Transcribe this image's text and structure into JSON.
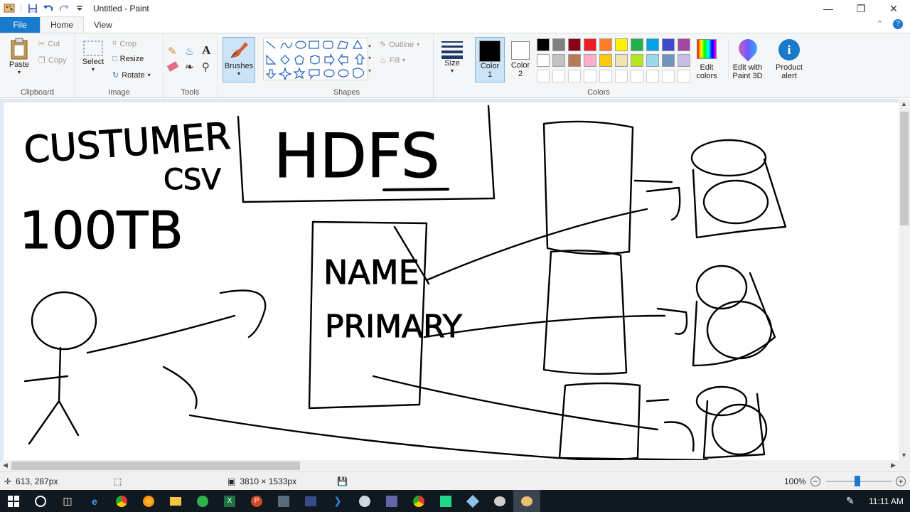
{
  "window": {
    "title": "Untitled - Paint",
    "controls": [
      "minimize-icon",
      "restore-icon",
      "close-icon"
    ]
  },
  "tabs": [
    {
      "label": "File"
    },
    {
      "label": "Home"
    },
    {
      "label": "View"
    }
  ],
  "ribbon": {
    "clipboard": {
      "label": "Clipboard",
      "paste": "Paste",
      "cut": "Cut",
      "copy": "Copy"
    },
    "image": {
      "label": "Image",
      "select": "Select",
      "crop": "Crop",
      "resize": "Resize",
      "rotate": "Rotate"
    },
    "tools": {
      "label": "Tools"
    },
    "brushes": {
      "label": "Brushes"
    },
    "shapes": {
      "label": "Shapes",
      "outline": "Outline",
      "fill": "Fill"
    },
    "size": {
      "label": "Size"
    },
    "colors": {
      "label": "Colors",
      "color1": "Color",
      "color1_num": "1",
      "color2": "Color",
      "color2_num": "2",
      "edit_colors_1": "Edit",
      "edit_colors_2": "colors",
      "palette_row1": [
        "#000000",
        "#7f7f7f",
        "#880015",
        "#ed1c24",
        "#ff7f27",
        "#fff200",
        "#22b14c",
        "#00a2e8",
        "#3f48cc",
        "#a349a4"
      ],
      "palette_row2": [
        "#ffffff",
        "#c3c3c3",
        "#b97a57",
        "#ffaec9",
        "#ffc90e",
        "#efe4b0",
        "#b5e61d",
        "#99d9ea",
        "#7092be",
        "#c8bfe7"
      ]
    },
    "paint3d": {
      "line1": "Edit with",
      "line2": "Paint 3D"
    },
    "product_alert": {
      "line1": "Product",
      "line2": "alert"
    }
  },
  "canvas": {
    "sketch_text": {
      "customer": "CUSTUMER",
      "csv": "CSV",
      "size": "100TB",
      "hdfs": "HDFS",
      "name": "NAME",
      "primary": "PRIMARY"
    }
  },
  "status": {
    "cursor_pos": "613, 287px",
    "image_size": "3810 × 1533px",
    "zoom": "100%"
  },
  "taskbar": {
    "time": "11:11 AM"
  }
}
